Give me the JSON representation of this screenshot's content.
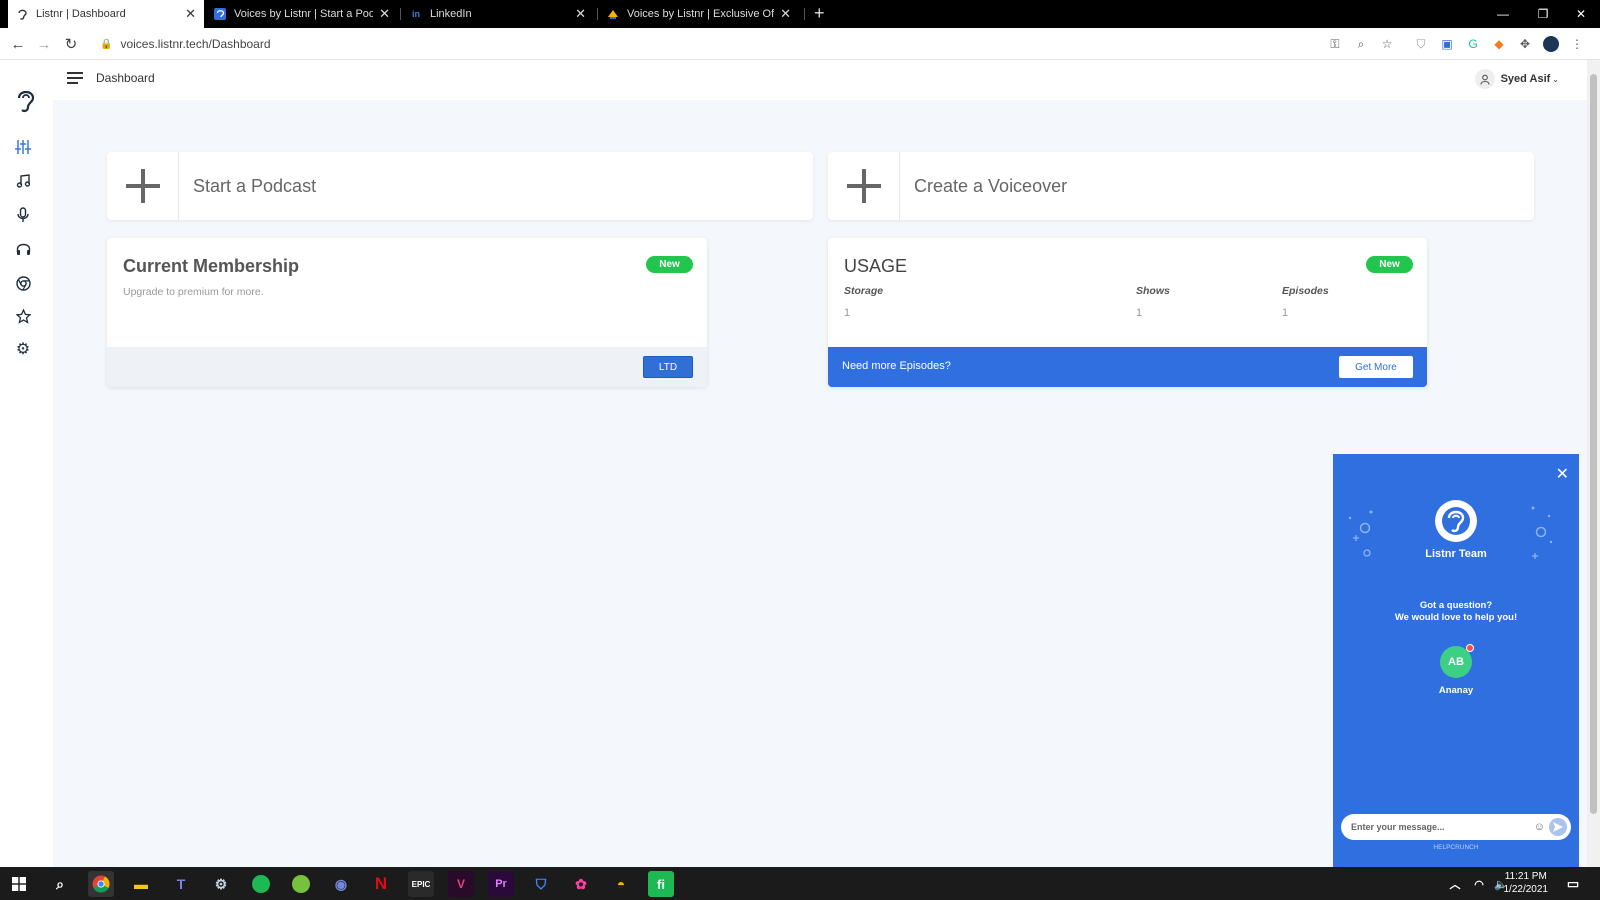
{
  "browser": {
    "tabs": [
      {
        "title": "Listnr | Dashboard",
        "active": true
      },
      {
        "title": "Voices by Listnr | Start a Podcast",
        "active": false
      },
      {
        "title": "LinkedIn",
        "active": false
      },
      {
        "title": "Voices by Listnr | Exclusive Offer",
        "active": false
      }
    ],
    "url": "voices.listnr.tech/Dashboard"
  },
  "header": {
    "title": "Dashboard",
    "user_name": "Syed Asif"
  },
  "sidebar": {
    "items": [
      "logo-ear",
      "mixer",
      "music",
      "microphone",
      "headphones",
      "chrome",
      "star",
      "settings"
    ]
  },
  "actions": {
    "podcast_label": "Start a Podcast",
    "voiceover_label": "Create a Voiceover"
  },
  "membership": {
    "title": "Current Membership",
    "subtitle": "Upgrade to premium for more.",
    "badge": "New",
    "button": "LTD"
  },
  "usage": {
    "title": "USAGE",
    "badge": "New",
    "columns": [
      {
        "label": "Storage",
        "value": "1"
      },
      {
        "label": "Shows",
        "value": "1"
      },
      {
        "label": "Episodes",
        "value": "1"
      }
    ],
    "footer_text": "Need more Episodes?",
    "footer_button": "Get More"
  },
  "chat": {
    "team_name": "Listnr Team",
    "question_line1": "Got a question?",
    "question_line2": "We would love to help you!",
    "agent_initials": "AB",
    "agent_name": "Ananay",
    "input_placeholder": "Enter your message...",
    "powered_by": "HELPCRUNCH"
  },
  "taskbar": {
    "time": "11:21 PM",
    "date": "1/22/2021"
  },
  "colors": {
    "accent": "#2f6fe0",
    "badge_green": "#22c54d",
    "page_bg": "#f4f7fb"
  }
}
